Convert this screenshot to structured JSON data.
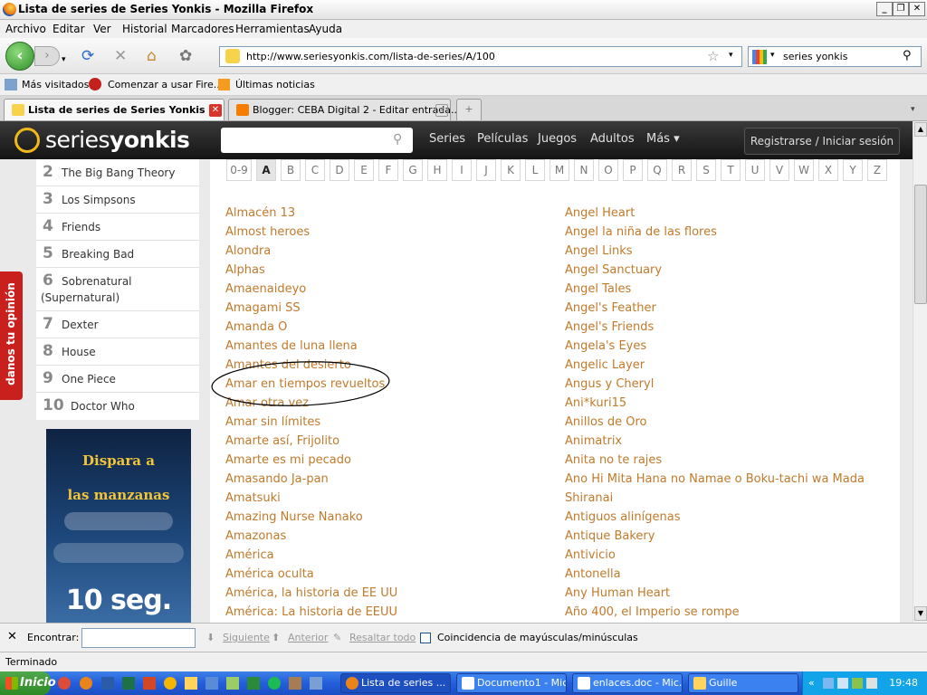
{
  "window": {
    "title": "Lista de series de Series Yonkis - Mozilla Firefox"
  },
  "menu": [
    "Archivo",
    "Editar",
    "Ver",
    "Historial",
    "Marcadores",
    "Herramientas",
    "Ayuda"
  ],
  "url": "http://www.seriesyonkis.com/lista-de-series/A/100",
  "search": {
    "value": "series yonkis"
  },
  "bookmarks": [
    "Más visitados",
    "Comenzar a usar Fire...",
    "Últimas noticias"
  ],
  "tabs": [
    "Lista de series de Series Yonkis",
    "Blogger: CEBA Digital 2 - Editar entrada..."
  ],
  "site": {
    "logo_pre": "series",
    "logo_bold": "yonkis",
    "nav": [
      "Series",
      "Películas",
      "Juegos",
      "Adultos",
      "Más ▾"
    ],
    "login": "Registrarse / Iniciar sesión",
    "opinion": "danos tu opinión",
    "ranking": [
      {
        "n": "2",
        "t": "The Big Bang Theory"
      },
      {
        "n": "3",
        "t": "Los Simpsons"
      },
      {
        "n": "4",
        "t": "Friends"
      },
      {
        "n": "5",
        "t": "Breaking Bad"
      },
      {
        "n": "6",
        "t": "Sobrenatural",
        "t2": "(Supernatural)"
      },
      {
        "n": "7",
        "t": "Dexter"
      },
      {
        "n": "8",
        "t": "House"
      },
      {
        "n": "9",
        "t": "One Piece"
      },
      {
        "n": "10",
        "t": "Doctor Who"
      }
    ],
    "ad": {
      "l1": "Dispara a",
      "l2": "las manzanas",
      "l3": "10 seg."
    },
    "letters": [
      "0-9",
      "A",
      "B",
      "C",
      "D",
      "E",
      "F",
      "G",
      "H",
      "I",
      "J",
      "K",
      "L",
      "M",
      "N",
      "O",
      "P",
      "Q",
      "R",
      "S",
      "T",
      "U",
      "V",
      "W",
      "X",
      "Y",
      "Z"
    ],
    "selected_letter": "A",
    "col1": [
      "Almacén 13",
      "Almost heroes",
      "Alondra",
      "Alphas",
      "Amaenaideyo",
      "Amagami SS",
      "Amanda O",
      "Amantes de luna llena",
      "Amantes del desierto",
      "Amar en tiempos revueltos",
      "Amar otra vez",
      "Amar sin límites",
      "Amarte así, Frijolito",
      "Amarte es mi pecado",
      "Amasando Ja-pan",
      "Amatsuki",
      "Amazing Nurse Nanako",
      "Amazonas",
      "América",
      "América oculta",
      "América, la historia de EE UU",
      "América: La historia de EEUU"
    ],
    "col2": [
      "Angel Heart",
      "Angel la niña de las flores",
      "Angel Links",
      "Angel Sanctuary",
      "Angel Tales",
      "Angel's Feather",
      "Angel's Friends",
      "Angela's Eyes",
      "Angelic Layer",
      "Angus y Cheryl",
      "Ani*kuri15",
      "Anillos de Oro",
      "Animatrix",
      "Anita no te rajes",
      "Ano Hi Mita Hana no Namae o Boku-tachi wa Mada",
      "Shiranai",
      "Antiguos alinígenas",
      "Antique Bakery",
      "Antivicio",
      "Antonella",
      "Any Human Heart",
      "Año 400, el Imperio se rompe"
    ]
  },
  "find": {
    "label": "Encontrar:",
    "next": "Siguiente",
    "prev": "Anterior",
    "highlight": "Resaltar todo",
    "match_case": "Coincidencia de mayúsculas/minúsculas"
  },
  "status": "Terminado",
  "taskbar": {
    "start": "Inicio",
    "items": [
      "Lista de series ...",
      "Documento1 - Mic...",
      "enlaces.doc - Mic...",
      "Guille"
    ],
    "clock": "19:48"
  }
}
